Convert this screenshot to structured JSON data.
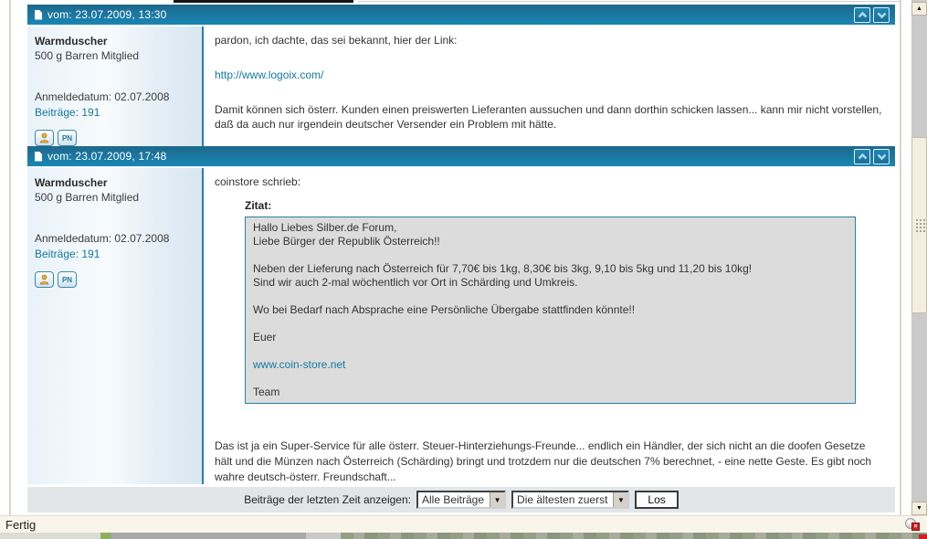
{
  "colors": {
    "header_gradient_top": "#1d688c",
    "header_gradient_bottom": "#1886b4",
    "accent_teal": "#2a80a6",
    "link": "#1479a4",
    "quote_bg": "#dcdcdc",
    "footer_bar_bg": "#e3e6e9",
    "status_bar_bg": "#faf5ea",
    "scrollbar_thumb": "#f3eee0"
  },
  "browser": {
    "status_text": "Fertig"
  },
  "posts": [
    {
      "header_label": "vom: 23.07.2009, 13:30",
      "author": {
        "name": "Warmduscher",
        "rank": "500 g Barren Mitglied",
        "joined": "Anmeldedatum: 02.07.2008",
        "post_count": "Beiträge: 191",
        "pn_button": "PN"
      },
      "body": {
        "intro": "pardon, ich dachte, das sei bekannt, hier der Link:",
        "link": "http://www.logoix.com/",
        "text": "Damit können sich österr. Kunden einen preiswerten Lieferanten aussuchen und dann dorthin schicken lassen... kann mir nicht vorstellen, daß da auch nur irgendein deutscher Versender ein Problem mit hätte."
      }
    },
    {
      "header_label": "vom: 23.07.2009, 17:48",
      "author": {
        "name": "Warmduscher",
        "rank": "500 g Barren Mitglied",
        "joined": "Anmeldedatum: 02.07.2008",
        "post_count": "Beiträge: 191",
        "pn_button": "PN"
      },
      "body": {
        "intro": "coinstore schrieb:",
        "quote_label": "Zitat:",
        "quote_lines": [
          "Hallo Liebes Silber.de Forum,",
          "Liebe Bürger der Republik Österreich!!",
          "",
          "Neben der Lieferung nach Österreich für 7,70€ bis 1kg, 8,30€ bis 3kg, 9,10 bis 5kg und 11,20 bis 10kg!",
          "Sind wir auch 2-mal wöchentlich vor Ort in Schärding und Umkreis.",
          "",
          "Wo bei Bedarf nach Absprache eine Persönliche Übergabe stattfinden könnte!!",
          "",
          "Euer",
          ""
        ],
        "quote_link": "www.coin-store.net",
        "quote_after_link": [
          "",
          "Team"
        ],
        "comment": "Das ist ja ein Super-Service für alle österr. Steuer-Hinterziehungs-Freunde... endlich ein Händler, der sich nicht an die doofen Gesetze hält und die Münzen nach Österreich (Schärding) bringt und trotzdem nur die deutschen 7% berechnet, - eine nette Geste. Es gibt noch wahre deutsch-österr. Freundschaft..."
      }
    }
  ],
  "footer": {
    "label": "Beiträge der letzten Zeit anzeigen:",
    "time_filter_value": "Alle Beiträge",
    "order_value": "Die ältesten zuerst",
    "go_label": "Los"
  }
}
